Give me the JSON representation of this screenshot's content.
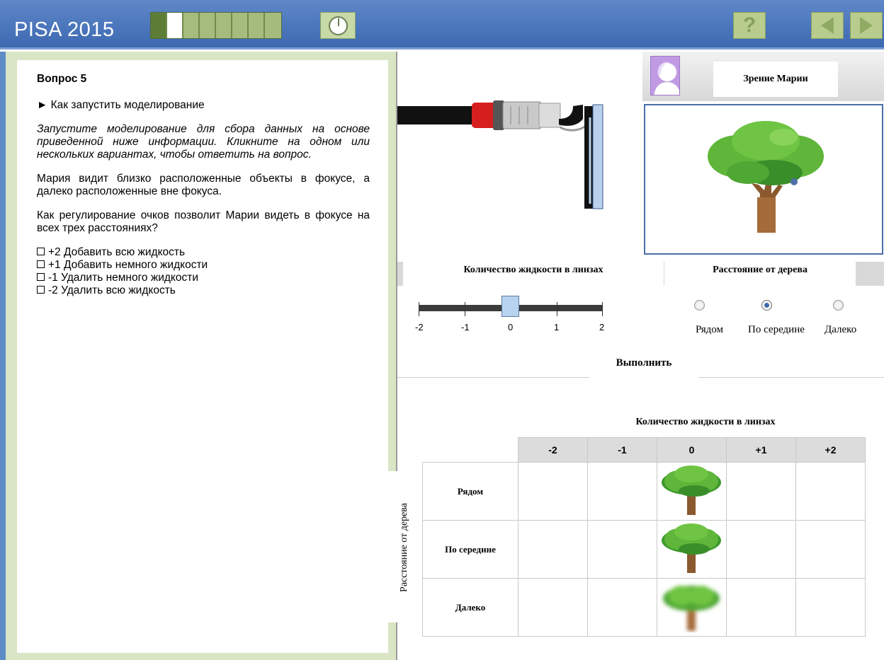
{
  "header": {
    "brand": "PISA 2015",
    "progress_cells": [
      "done",
      "current",
      "todo",
      "todo",
      "todo",
      "todo",
      "todo",
      "todo"
    ],
    "help_label": "?",
    "icons": [
      "timer-icon",
      "help-icon",
      "prev-arrow-icon",
      "next-arrow-icon"
    ]
  },
  "question": {
    "title": "Вопрос 5",
    "how_to_link": "► Как запустить моделирование",
    "instruction": "Запустите моделирование для сбора данных на основе приведенной ниже информации. Кликните на одном или нескольких вариантах, чтобы ответить на вопрос.",
    "context": "Мария видит близко расположенные объекты в фокусе, а далеко расположенные вне фокуса.",
    "prompt": "Как регулирование очков позволит Марии видеть в фокусе на всех трех расстояниях?",
    "options": [
      "+2 Добавить всю жидкость",
      "+1 Добавить немного жидкости",
      "-1 Удалить немного жидкости",
      "-2 Удалить всю жидкость"
    ]
  },
  "simulation": {
    "vision_title": "Зрение Марии",
    "fluid_tab": "Количество жидкости в линзах",
    "distance_tab": "Расстояние от дерева",
    "slider": {
      "ticks": [
        "-2",
        "-1",
        "0",
        "1",
        "2"
      ],
      "value": 0
    },
    "distance_options": [
      "Рядом",
      "По середине",
      "Далеко"
    ],
    "selected_distance": "По середине",
    "run_label": "Выполнить"
  },
  "results": {
    "title": "Количество жидкости в линзах",
    "row_axis_label": "Расстояние от дерева",
    "columns": [
      "-2",
      "-1",
      "0",
      "+1",
      "+2"
    ],
    "rows": [
      {
        "label": "Рядом",
        "cells": [
          "",
          "",
          "tree-sharp",
          "",
          ""
        ]
      },
      {
        "label": "По середине",
        "cells": [
          "",
          "",
          "tree-sharp",
          "",
          ""
        ]
      },
      {
        "label": "Далеко",
        "cells": [
          "",
          "",
          "tree-blurred",
          "",
          ""
        ]
      }
    ]
  }
}
